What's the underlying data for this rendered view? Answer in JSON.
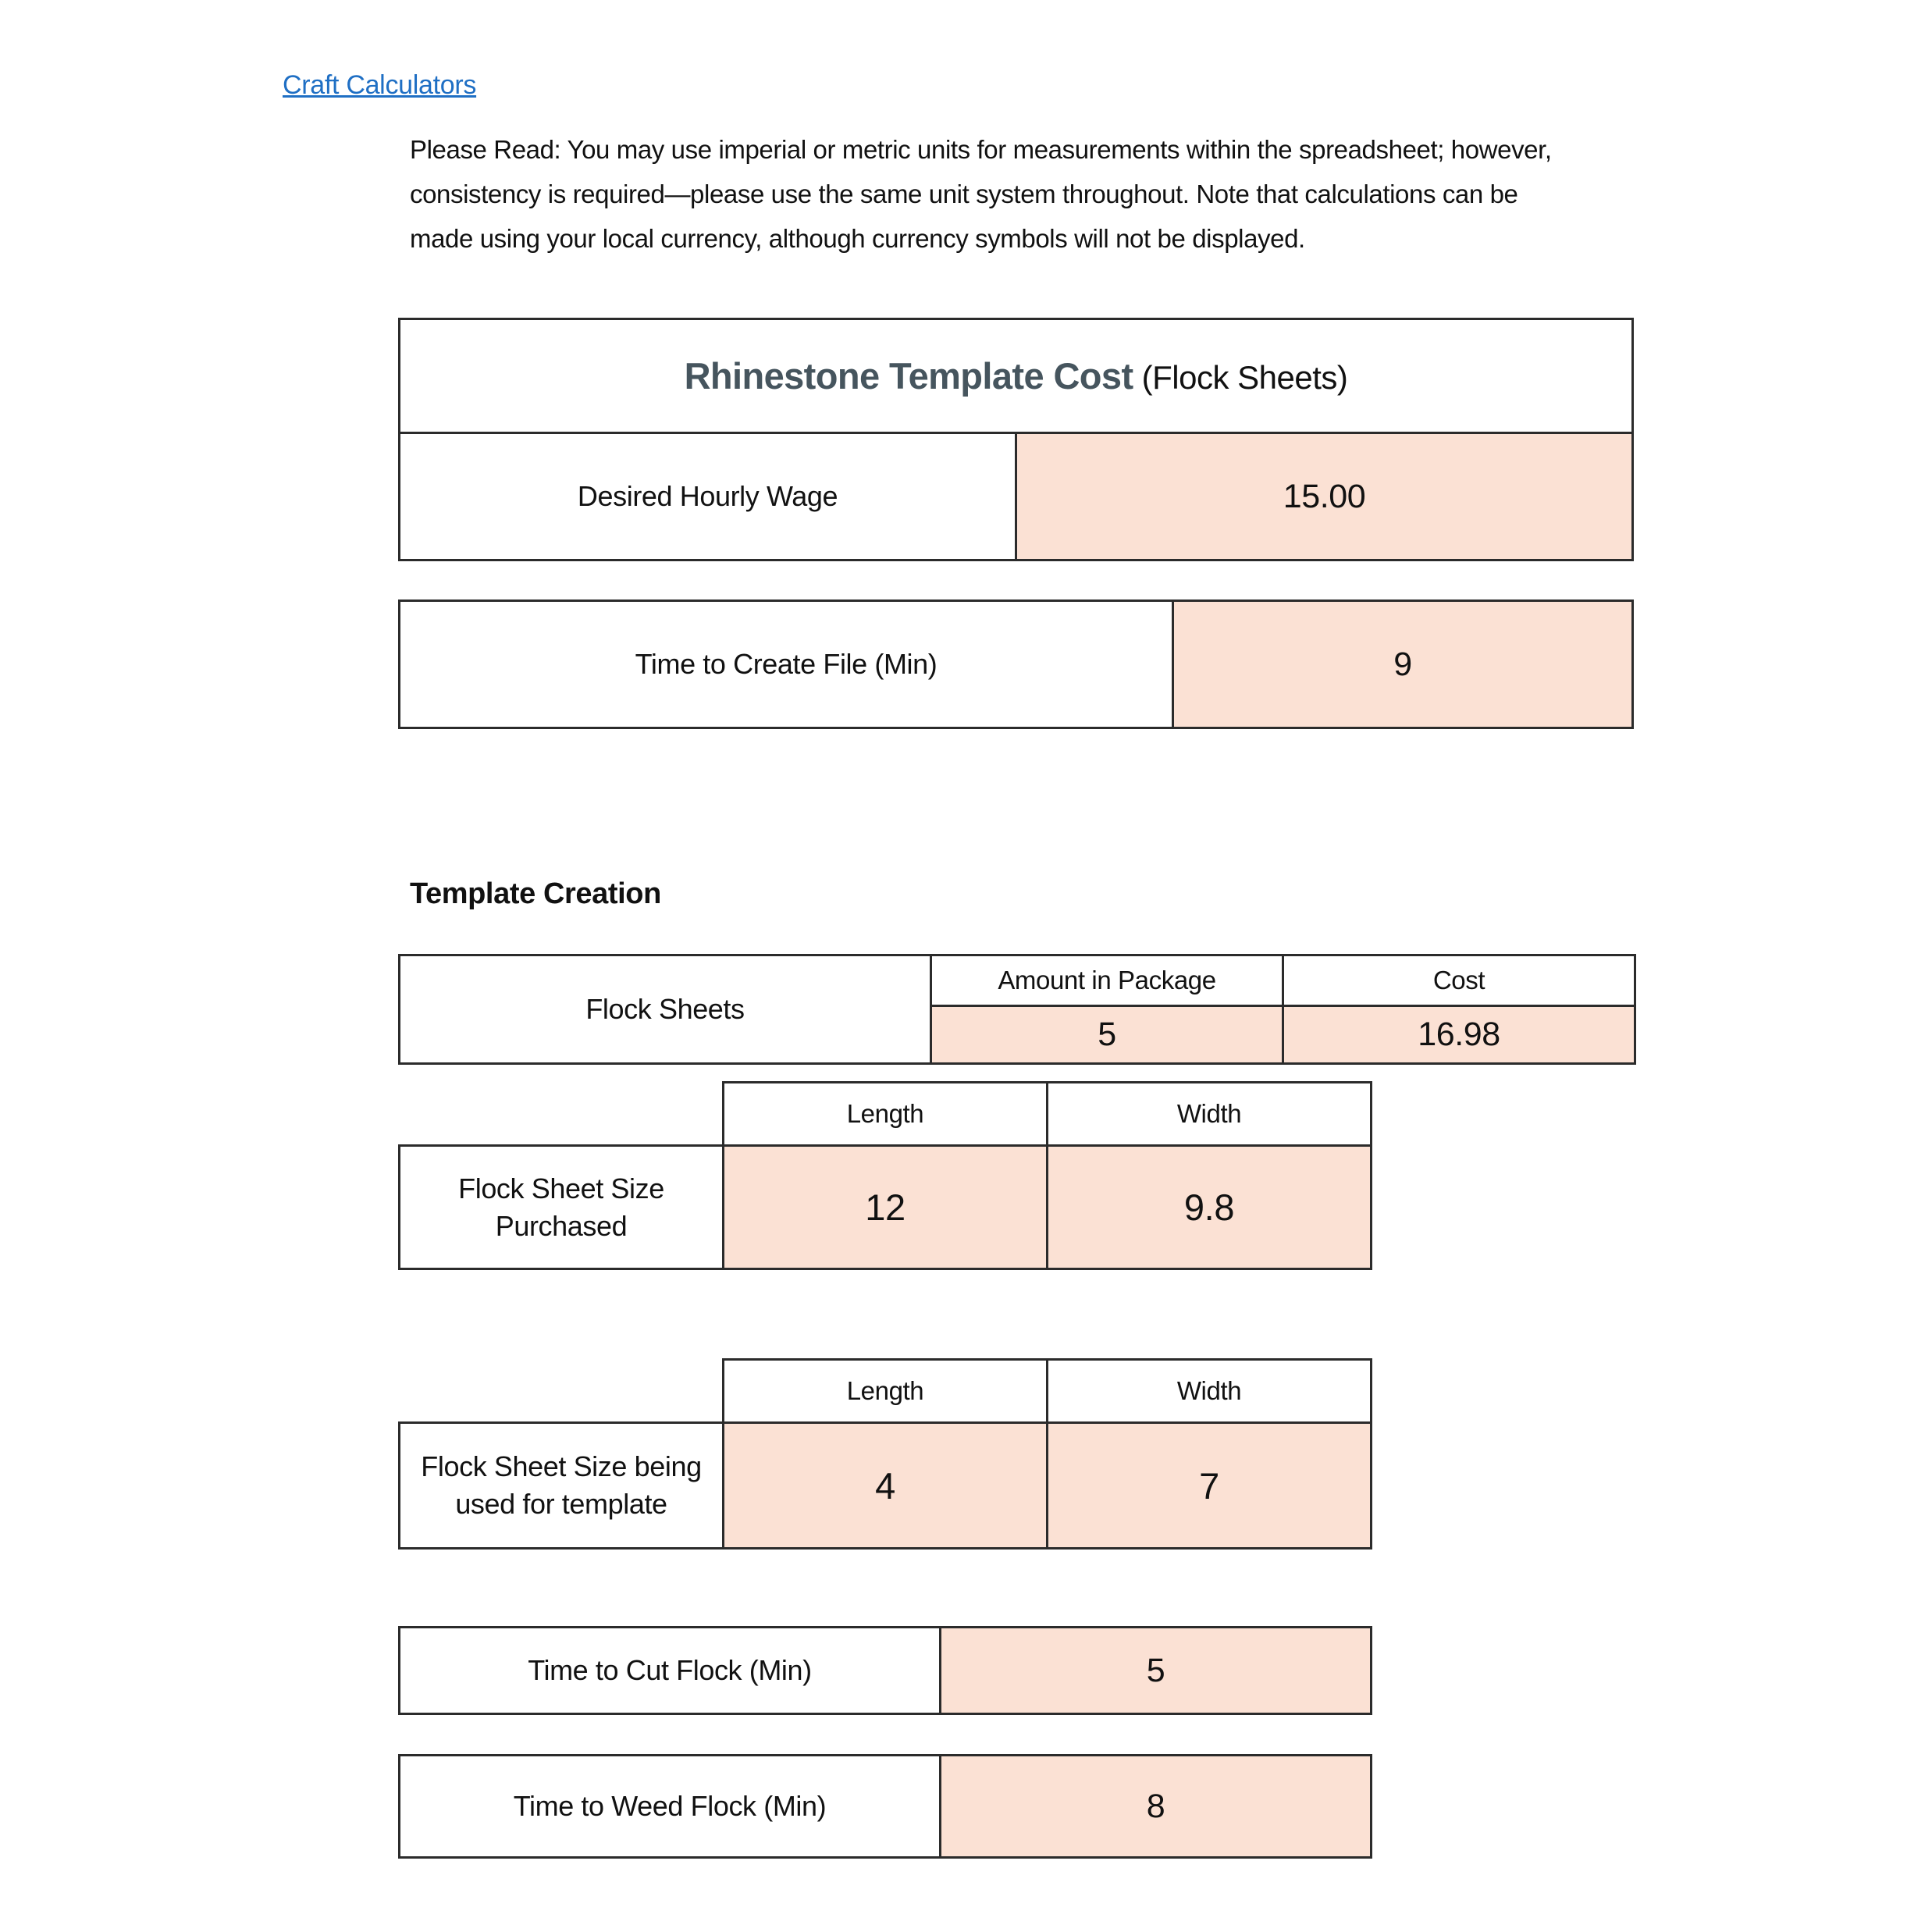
{
  "header": {
    "link_label": "Craft Calculators",
    "link_color": "#1f6fc4"
  },
  "intro": {
    "text": "Please Read: You may use imperial or metric units for measurements within the spreadsheet; however, consistency is required—please use the same unit system throughout. Note that calculations can be made using your local currency, although currency symbols will not be displayed."
  },
  "colors": {
    "input_fill": "#fbe1d4",
    "border": "#2b2b2b",
    "title_text": "#46555e"
  },
  "cost_table": {
    "title_main": "Rhinestone Template Cost",
    "title_sub": " (Flock Sheets)",
    "wage_label": "Desired Hourly Wage",
    "wage_value": "15.00"
  },
  "create_file_table": {
    "label": "Time to Create File (Min)",
    "value": "9"
  },
  "section": {
    "heading": "Template Creation"
  },
  "flock_sheets_table": {
    "name": "Flock Sheets",
    "headers": [
      "Amount in Package",
      "Cost"
    ],
    "values": [
      "5",
      "16.98"
    ]
  },
  "purchased_table": {
    "name": "Flock Sheet Size Purchased",
    "headers": [
      "Length",
      "Width"
    ],
    "values": [
      "12",
      "9.8"
    ]
  },
  "used_table": {
    "name": "Flock Sheet Size being used for template",
    "headers": [
      "Length",
      "Width"
    ],
    "values": [
      "4",
      "7"
    ]
  },
  "cut_flock_table": {
    "label": "Time to Cut Flock (Min)",
    "value": "5"
  },
  "weed_flock_table": {
    "label": "Time to Weed Flock (Min)",
    "value": "8"
  }
}
